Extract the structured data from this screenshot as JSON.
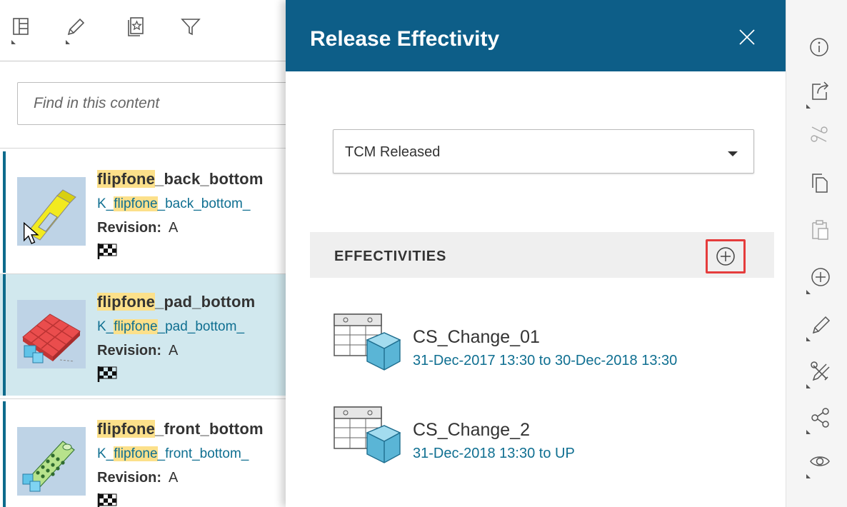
{
  "toolbar": {
    "buttons": [
      "layout-panel-icon",
      "edit-pencil-icon",
      "favorites-icon",
      "filter-icon"
    ]
  },
  "search": {
    "placeholder": "Find in this content",
    "value": ""
  },
  "results": [
    {
      "title_highlight": "flipfone",
      "title_rest": "_back_bottom",
      "id_prefix": "K_",
      "id_highlight": "flipfone",
      "id_rest": "_back_bottom_",
      "revision_label": "Revision:",
      "revision": "A",
      "selected": false
    },
    {
      "title_highlight": "flipfone",
      "title_rest": "_pad_bottom",
      "id_prefix": "K_",
      "id_highlight": "flipfone",
      "id_rest": "_pad_bottom_",
      "revision_label": "Revision:",
      "revision": "A",
      "selected": true
    },
    {
      "title_highlight": "flipfone",
      "title_rest": "_front_bottom",
      "id_prefix": "K_",
      "id_highlight": "flipfone",
      "id_rest": "_front_bottom_",
      "revision_label": "Revision:",
      "revision": "A",
      "selected": false
    }
  ],
  "panel": {
    "title": "Release Effectivity",
    "release_status": {
      "selected": "TCM Released"
    },
    "effectivities": {
      "heading": "EFFECTIVITIES",
      "items": [
        {
          "name": "CS_Change_01",
          "range": "31-Dec-2017 13:30 to 30-Dec-2018 13:30"
        },
        {
          "name": "CS_Change_2",
          "range": "31-Dec-2018 13:30 to UP"
        }
      ]
    }
  },
  "rail": {
    "buttons": [
      "info-icon",
      "share-out-icon",
      "cut-scissors-icon",
      "copy-icon",
      "paste-icon",
      "add-icon",
      "edit-icon",
      "tools-icon",
      "relations-icon",
      "view-eye-icon"
    ]
  },
  "colors": {
    "header_bg": "#0d5e88",
    "link_text": "#0f6f91",
    "highlight": "#fce08a",
    "selection_bg": "#d1e8ee",
    "add_button_outline": "#e53c3c"
  }
}
